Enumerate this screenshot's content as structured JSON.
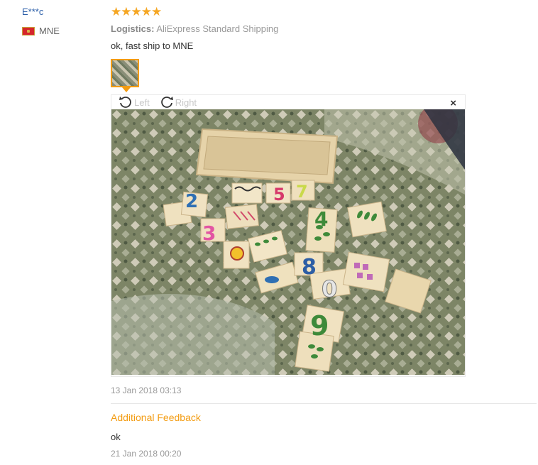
{
  "review": {
    "user_name": "E***c",
    "country_code": "MNE",
    "stars_text": "★★★★★",
    "logistics_label": "Logistics:",
    "logistics_value": "AliExpress Standard Shipping",
    "comment": "ok, fast ship to MNE",
    "date": "13 Jan 2018 03:13"
  },
  "viewer": {
    "rotate_left_label": "Left",
    "rotate_right_label": "Right",
    "close_icon": "×"
  },
  "puzzle_numbers": [
    "2",
    "5",
    "7",
    "3",
    "4",
    "8",
    "0",
    "9"
  ],
  "additional": {
    "title": "Additional Feedback",
    "text": "ok",
    "date": "21 Jan 2018 00:20"
  },
  "colors": {
    "accent": "#f39c12",
    "user_link": "#2a5ea8",
    "star": "#f5a623"
  }
}
